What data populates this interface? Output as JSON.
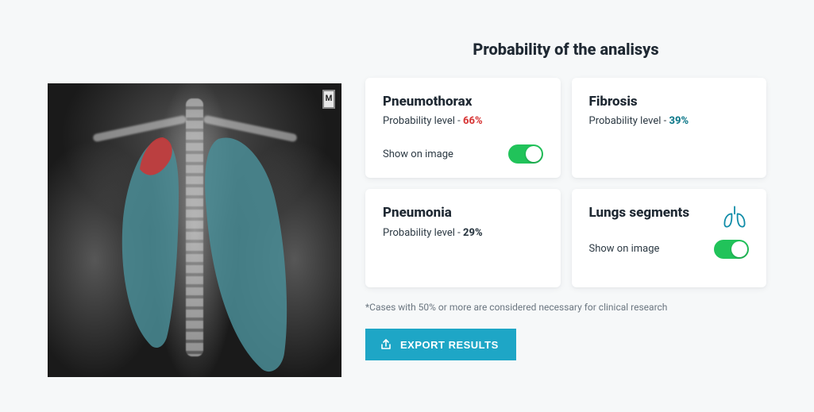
{
  "page": {
    "title": "Probability of the analisys",
    "footnote": "*Cases with 50% or more are considered necessary for clinical research",
    "export_label": "EXPORT RESULTS"
  },
  "xray": {
    "marker": "M",
    "overlay": {
      "lung_color": "#4a8d97",
      "pneumothorax_color": "#c63a3a"
    }
  },
  "cards": {
    "pneumothorax": {
      "title": "Pneumothorax",
      "prob_label": "Probability level - ",
      "prob_value": "66%",
      "show_label": "Show on image",
      "show_on": true
    },
    "fibrosis": {
      "title": "Fibrosis",
      "prob_label": "Probability level - ",
      "prob_value": "39%"
    },
    "pneumonia": {
      "title": "Pneumonia",
      "prob_label": "Probability level - ",
      "prob_value": "29%"
    },
    "lungs_segments": {
      "title": "Lungs segments",
      "show_label": "Show on image",
      "show_on": true
    }
  }
}
